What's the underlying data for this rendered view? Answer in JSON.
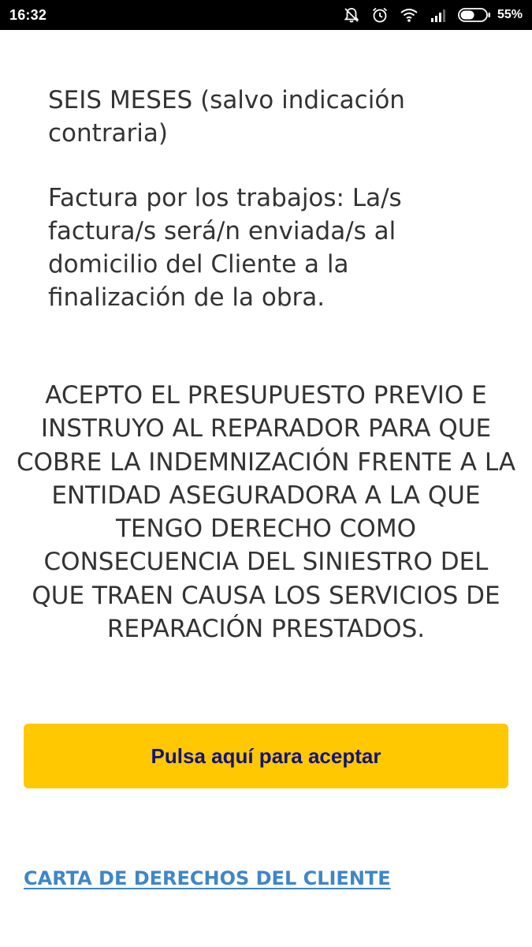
{
  "status_bar": {
    "time": "16:32",
    "battery_percent": "55%",
    "battery_level": 0.55,
    "icons": [
      "mute-icon",
      "alarm-icon",
      "wifi-icon",
      "signal-icon",
      "battery-icon"
    ]
  },
  "content": {
    "paragraph_duration": "SEIS MESES (salvo indicación contraria)",
    "paragraph_invoice": "Factura por los trabajos: La/s factura/s será/n enviada/s al domicilio del Cliente a la finalización de la obra.",
    "acceptance_text": "ACEPTO EL PRESUPUESTO PREVIO E INSTRUYO AL REPARADOR PARA QUE COBRE LA INDEMNIZACIÓN FRENTE A LA ENTIDAD ASEGURADORA A LA QUE TENGO DERECHO COMO CONSECUENCIA DEL SINIESTRO DEL QUE TRAEN CAUSA LOS SERVICIOS DE REPARACIÓN PRESTADOS.",
    "accept_button_label": "Pulsa aquí para aceptar",
    "rights_link_label": "CARTA DE DERECHOS DEL CLIENTE"
  },
  "colors": {
    "button_background": "#ffc800",
    "button_text": "#14137a",
    "link": "#3f86c7",
    "body_text": "#333333",
    "status_bar": "#000000"
  }
}
